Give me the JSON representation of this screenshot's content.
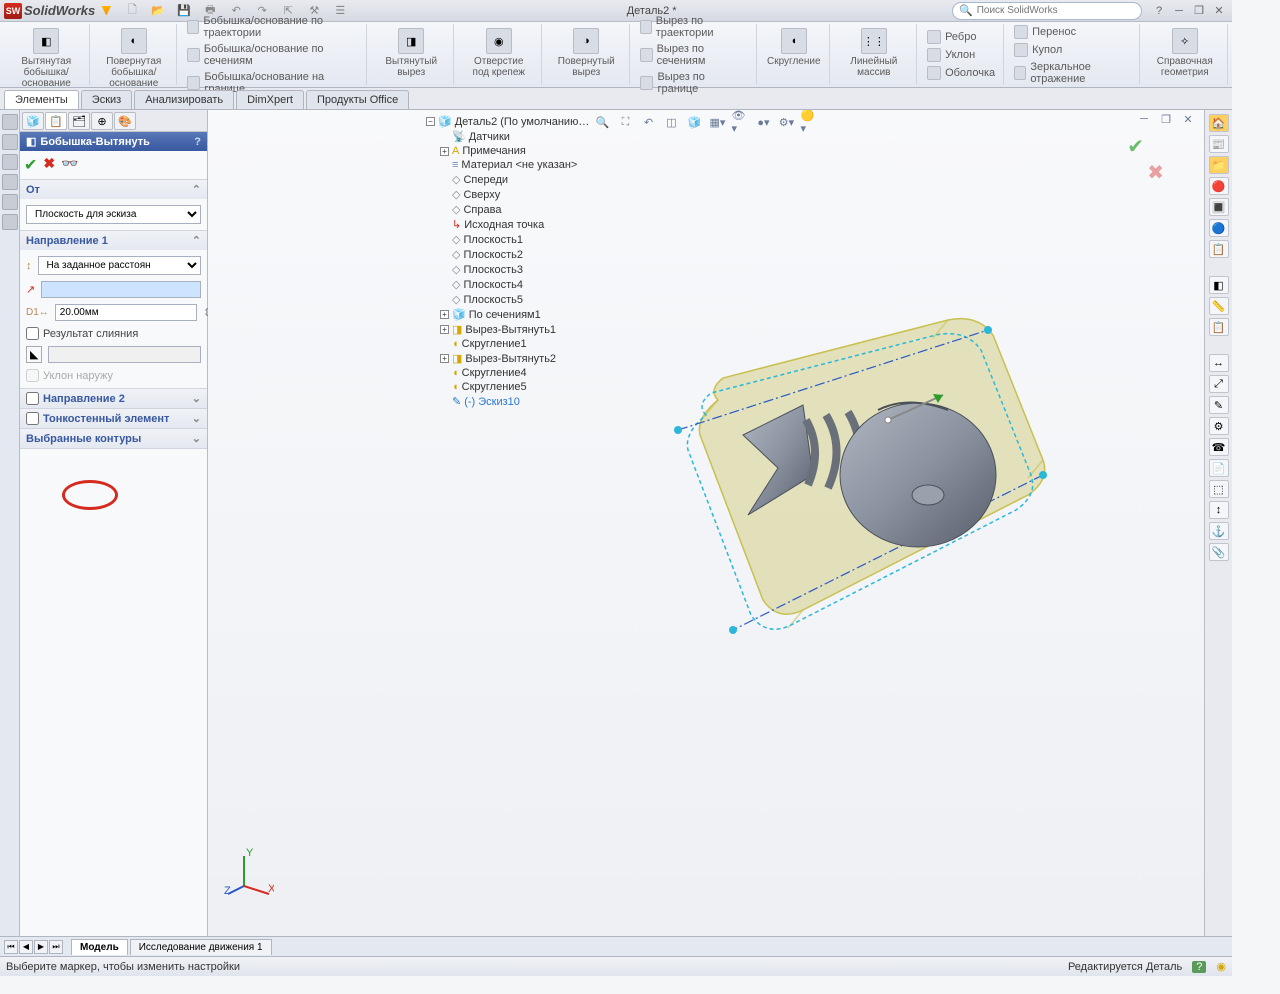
{
  "app": {
    "title": "SolidWorks",
    "doc": "Деталь2 *",
    "search_placeholder": "Поиск SolidWorks"
  },
  "ribbon": {
    "extruded_boss": "Вытянутая\nбобышка/основание",
    "revolved_boss": "Повернутая\nбобышка/основание",
    "swept_boss": "Бобышка/основание по траектории",
    "lofted_boss": "Бобышка/основание по сечениям",
    "boundary_boss": "Бобышка/основание на границе",
    "extruded_cut": "Вытянутый\nвырез",
    "hole": "Отверстие\nпод\nкрепеж",
    "revolved_cut": "Повернутый\nвырез",
    "swept_cut": "Вырез по траектории",
    "lofted_cut": "Вырез по сечениям",
    "boundary_cut": "Вырез по границе",
    "fillet": "Скругление",
    "pattern": "Линейный\nмассив",
    "rib": "Ребро",
    "draft": "Уклон",
    "shell": "Оболочка",
    "wrap": "Перенос",
    "dome": "Купол",
    "mirror": "Зеркальное отражение",
    "ref_geom": "Справочная\nгеометрия"
  },
  "tabs": {
    "elements": "Элементы",
    "sketch": "Эскиз",
    "analyze": "Анализировать",
    "dimxpert": "DimXpert",
    "office": "Продукты Office"
  },
  "pm": {
    "title": "Бобышка-Вытянуть",
    "from": "От",
    "from_select": "Плоскость для эскиза",
    "dir1": "Направление 1",
    "dir1_select": "На заданное расстоян",
    "depth": "20.00мм",
    "merge": "Результат слияния",
    "draft_out": "Уклон наружу",
    "dir2": "Направление 2",
    "thin": "Тонкостенный элемент",
    "contours": "Выбранные контуры"
  },
  "tree": {
    "root": "Деталь2  (По умолчанию…",
    "sensors": "Датчики",
    "annotations": "Примечания",
    "material": "Материал <не указан>",
    "front": "Спереди",
    "top": "Сверху",
    "right": "Справа",
    "origin": "Исходная точка",
    "plane1": "Плоскость1",
    "plane2": "Плоскость2",
    "plane3": "Плоскость3",
    "plane4": "Плоскость4",
    "plane5": "Плоскость5",
    "loft1": "По сечениям1",
    "cut1": "Вырез-Вытянуть1",
    "fillet1": "Скругление1",
    "cut2": "Вырез-Вытянуть2",
    "fillet4": "Скругление4",
    "fillet5": "Скругление5",
    "sketch10": "(-) Эскиз10"
  },
  "bottom": {
    "model": "Модель",
    "motion": "Исследование движения 1"
  },
  "status": {
    "hint": "Выберите маркер, чтобы изменить настройки",
    "edit": "Редактируется Деталь"
  }
}
